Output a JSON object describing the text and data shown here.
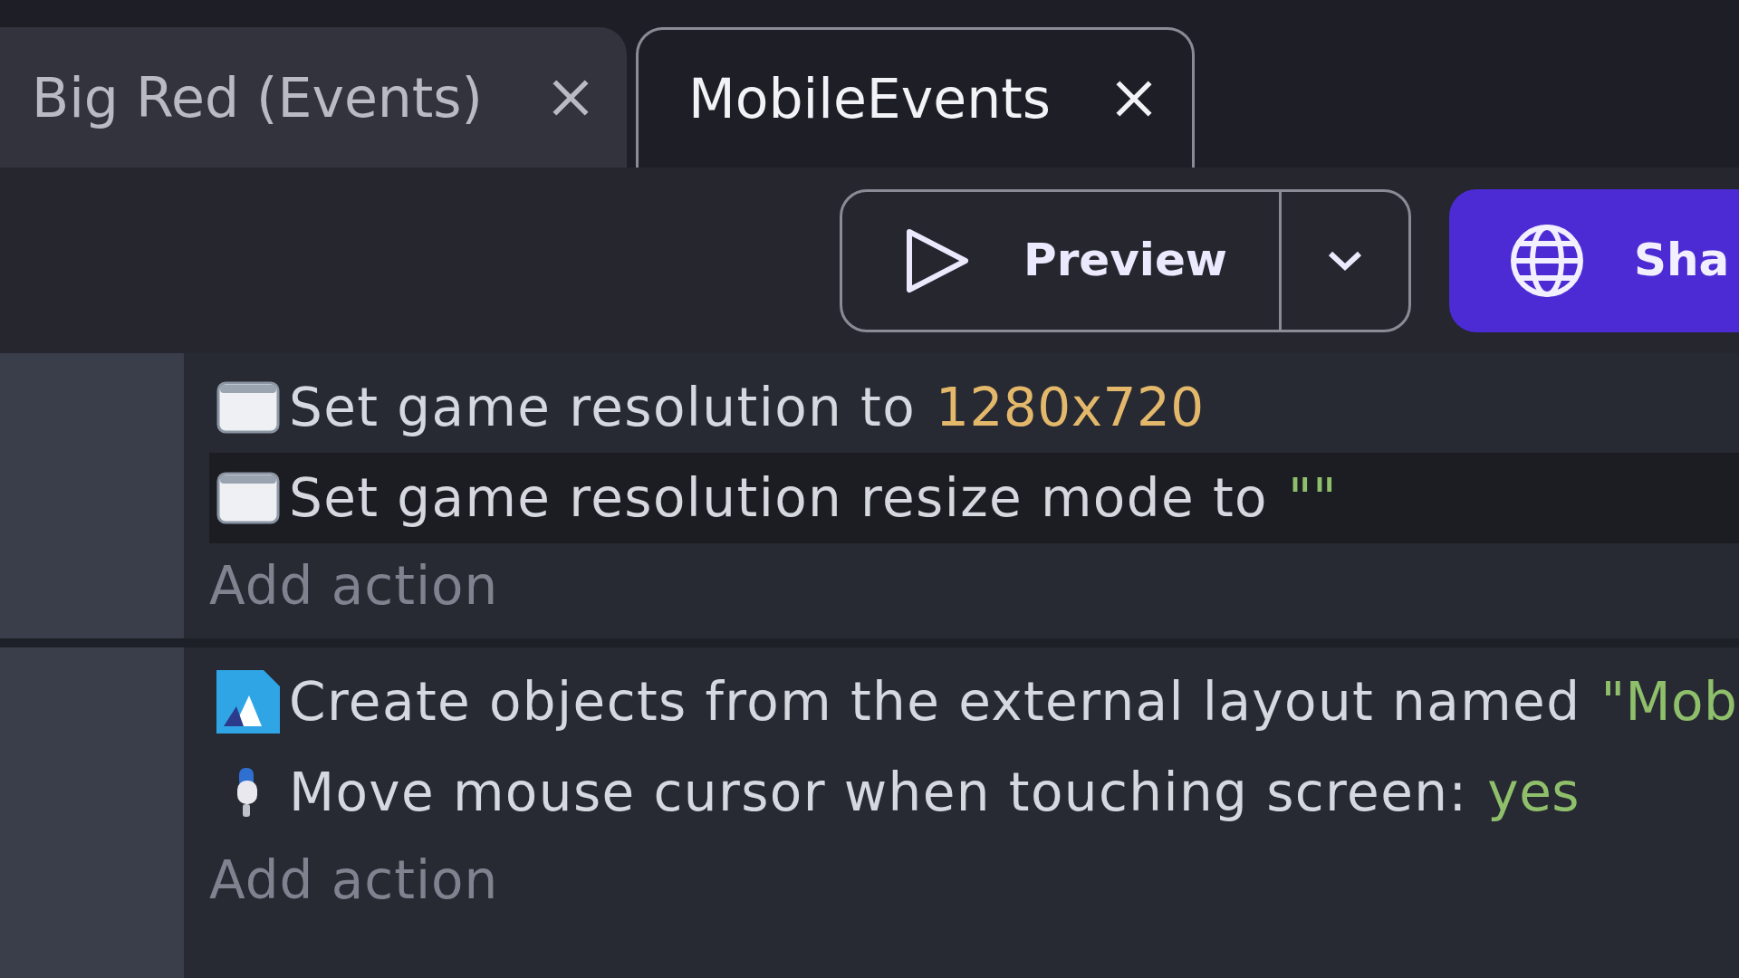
{
  "tabs": [
    {
      "label": "Big Red (Events)",
      "selected": false
    },
    {
      "label": "MobileEvents",
      "selected": true
    }
  ],
  "toolbar": {
    "preview_button": "Preview",
    "share_button": "Sha"
  },
  "events": [
    {
      "actions": [
        {
          "kind": "window",
          "text": "Set game resolution to",
          "value": {
            "text": "1280x720",
            "kind": "number"
          },
          "highlighted": false
        },
        {
          "kind": "window",
          "text": "Set game resolution resize mode to",
          "value": {
            "text": "\"\"",
            "kind": "string"
          },
          "highlighted": true
        }
      ],
      "add_action": "Add action"
    },
    {
      "actions": [
        {
          "kind": "layout",
          "text": "Create objects from the external layout named",
          "value": {
            "text": "\"Mob",
            "kind": "string"
          },
          "highlighted": false
        },
        {
          "kind": "touch",
          "text": "Move mouse cursor when touching screen:",
          "value": {
            "text": "yes",
            "kind": "boolean"
          },
          "highlighted": false
        }
      ],
      "add_action": "Add action"
    }
  ]
}
